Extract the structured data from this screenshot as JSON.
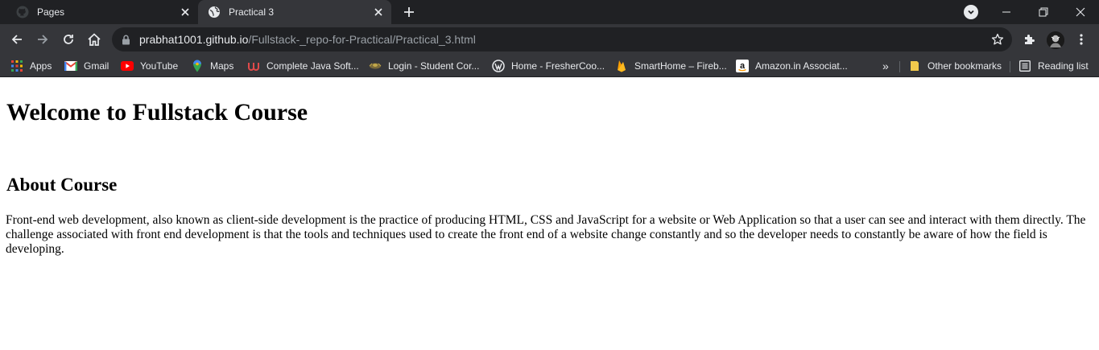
{
  "tabs": [
    {
      "title": "Pages",
      "favicon": "github-icon",
      "active": false
    },
    {
      "title": "Practical 3",
      "favicon": "globe-icon",
      "active": true
    }
  ],
  "address_bar": {
    "host": "prabhat1001.github.io",
    "path": "/Fullstack-_repo-for-Practical/Practical_3.html"
  },
  "bookmarks": [
    {
      "label": "Apps",
      "icon": "apps-grid-icon"
    },
    {
      "label": "Gmail",
      "icon": "gmail-icon"
    },
    {
      "label": "YouTube",
      "icon": "youtube-icon"
    },
    {
      "label": "Maps",
      "icon": "maps-icon"
    },
    {
      "label": "Complete Java Soft...",
      "icon": "udemy-icon"
    },
    {
      "label": "Login - Student Cor...",
      "icon": "portal-icon"
    },
    {
      "label": "Home - FresherCoo...",
      "icon": "wordpress-icon"
    },
    {
      "label": "SmartHome – Fireb...",
      "icon": "firebase-icon"
    },
    {
      "label": "Amazon.in Associat...",
      "icon": "amazon-icon"
    }
  ],
  "bookmarks_overflow": "»",
  "other_bookmarks": "Other bookmarks",
  "reading_list": "Reading list",
  "content": {
    "heading": "Welcome to Fullstack Course",
    "subheading": "About Course",
    "paragraph": "Front-end web development, also known as client-side development is the practice of producing HTML, CSS and JavaScript for a website or Web Application so that a user can see and interact with them directly. The challenge associated with front end development is that the tools and techniques used to create the front end of a website change constantly and so the developer needs to constantly be aware of how the field is developing."
  },
  "colors": {
    "tabstrip_bg": "#202124",
    "toolbar_bg": "#35363a",
    "omnibox_bg": "#202124",
    "text_light": "#e8eaed",
    "text_dim": "#9aa0a6"
  }
}
